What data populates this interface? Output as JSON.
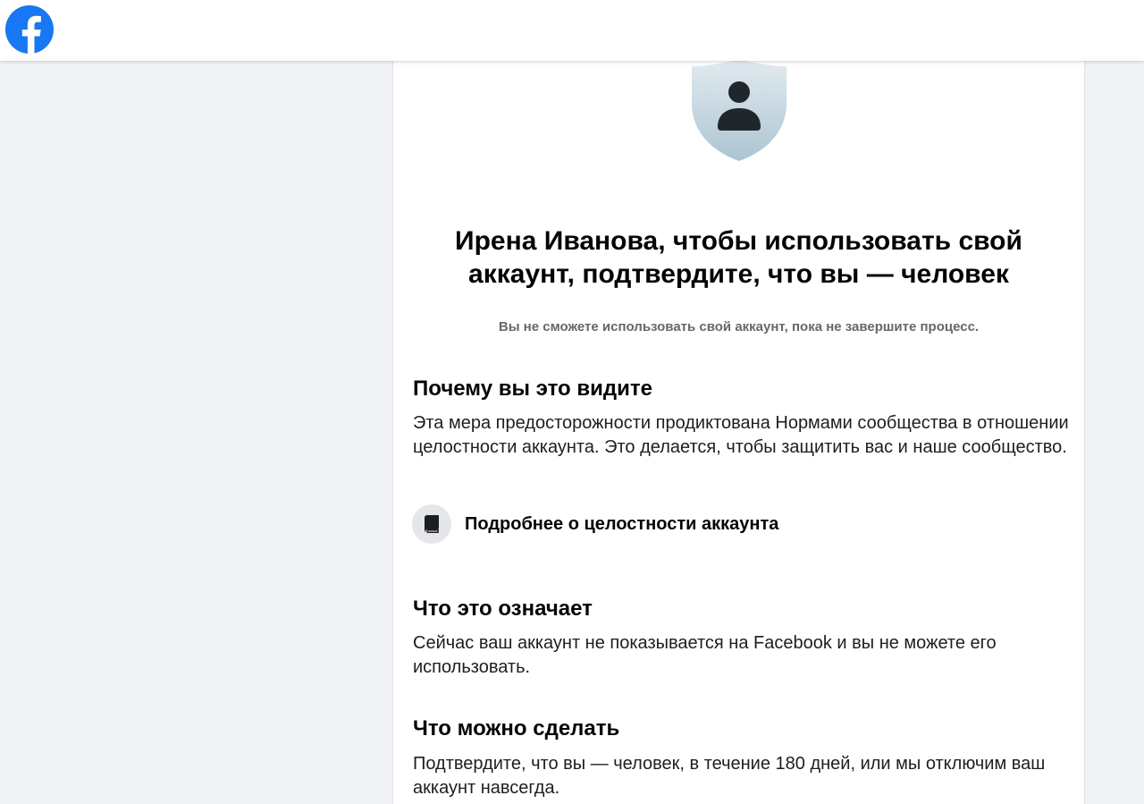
{
  "header": {
    "logo_icon": "facebook-logo-icon",
    "brand_color": "#1877f2"
  },
  "main": {
    "shield_icon": "shield-person-icon",
    "title": "Ирена Иванова, чтобы использовать свой аккаунт, подтвердите, что вы — человек",
    "subtitle": "Вы не сможете использовать свой аккаунт, пока не завершите процесс.",
    "sections": [
      {
        "heading": "Почему вы это видите",
        "body": "Эта мера предосторожности продиктована Нормами сообщества в отношении целостности аккаунта. Это делается, чтобы защитить вас и наше сообщество."
      },
      {
        "heading": "Что это означает",
        "body": "Сейчас ваш аккаунт не показывается на Facebook и вы не можете его использовать."
      },
      {
        "heading": "Что можно сделать",
        "body": "Подтвердите, что вы — человек, в течение 180 дней, или мы отключим ваш аккаунт навсегда."
      }
    ],
    "learn_more": {
      "icon": "book-icon",
      "label": "Подробнее о целостности аккаунта"
    }
  },
  "colors": {
    "page_background": "#f0f2f5",
    "card_background": "#ffffff",
    "text_primary": "#050505",
    "text_secondary": "#65676b",
    "icon_circle": "#e4e6eb",
    "shield_top": "#dfe8ee",
    "shield_bottom": "#b5cbd7"
  }
}
